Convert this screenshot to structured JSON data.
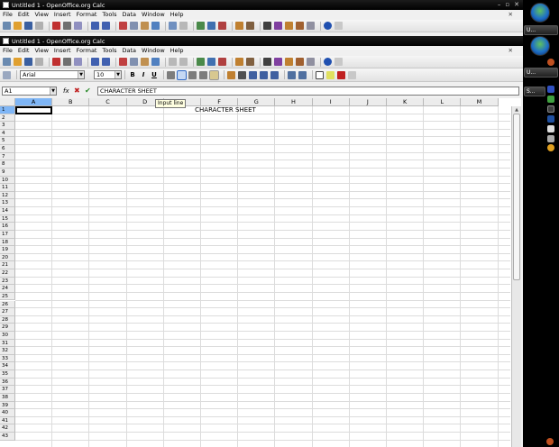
{
  "outer_window": {
    "title": "Untitled 1 - OpenOffice.org Calc",
    "window_buttons": [
      "–",
      "▫",
      "✕"
    ],
    "menu": [
      "File",
      "Edit",
      "View",
      "Insert",
      "Format",
      "Tools",
      "Data",
      "Window",
      "Help"
    ],
    "menu_close": "✕"
  },
  "inner_window": {
    "title": "Untitled 1 - OpenOffice.org Calc",
    "window_buttons": [
      "–",
      "▫",
      "✕"
    ],
    "menu": [
      "File",
      "Edit",
      "View",
      "Insert",
      "Format",
      "Tools",
      "Data",
      "Window",
      "Help"
    ],
    "menu_close": "✕"
  },
  "formatting": {
    "font_name": "Arial",
    "font_size": "10",
    "bold": "B",
    "italic": "I",
    "underline": "U"
  },
  "input_line": {
    "cell_ref": "A1",
    "function_icon": "fx",
    "cancel_icon": "✖",
    "accept_icon": "✔",
    "formula_value": "CHARACTER SHEET"
  },
  "tooltip": "Input line",
  "sheet": {
    "columns": [
      "A",
      "B",
      "C",
      "D",
      "E",
      "F",
      "G",
      "H",
      "I",
      "J",
      "K",
      "L",
      "M"
    ],
    "rows": [
      "1",
      "2",
      "3",
      "4",
      "5",
      "6",
      "7",
      "8",
      "9",
      "10",
      "11",
      "12",
      "13",
      "14",
      "15",
      "16",
      "17",
      "18",
      "19",
      "20",
      "21",
      "22",
      "23",
      "24",
      "25",
      "26",
      "27",
      "28",
      "29",
      "30",
      "31",
      "32",
      "33",
      "34",
      "35",
      "36",
      "37",
      "38",
      "39",
      "40",
      "41",
      "42",
      "43"
    ],
    "selected_cell": "A1",
    "cell_text": "CHARACTER SHEET"
  },
  "taskbar": {
    "tasks": [
      "U...",
      "U...",
      "S..."
    ]
  },
  "colors": {
    "selection": "#7fb6f6",
    "header_bg": "#ececec",
    "tooltip_bg": "#ffffe1"
  }
}
